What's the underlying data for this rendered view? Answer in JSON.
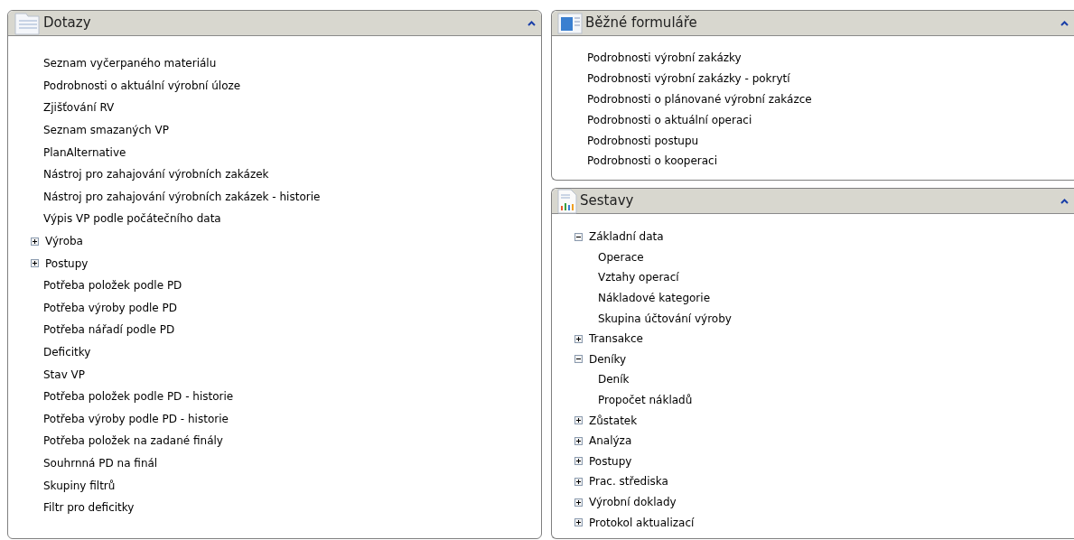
{
  "panels": [
    {
      "title": "Dotazy",
      "items": [
        {
          "kind": "link",
          "label": "Seznam vyčerpaného materiálu"
        },
        {
          "kind": "link",
          "label": "Podrobnosti o aktuální výrobní úloze"
        },
        {
          "kind": "link",
          "label": "Zjišťování RV"
        },
        {
          "kind": "link",
          "label": "Seznam smazaných VP"
        },
        {
          "kind": "link",
          "label": "PlanAlternative"
        },
        {
          "kind": "link",
          "label": "Nástroj pro zahajování výrobních zakázek"
        },
        {
          "kind": "link",
          "label": "Nástroj pro zahajování výrobních zakázek - historie"
        },
        {
          "kind": "link",
          "label": "Výpis VP podle počátečního data"
        },
        {
          "kind": "group",
          "label": "Výroba",
          "expanded": false
        },
        {
          "kind": "group",
          "label": "Postupy",
          "expanded": false
        },
        {
          "kind": "link",
          "label": "Potřeba položek podle PD"
        },
        {
          "kind": "link",
          "label": "Potřeba výroby podle PD"
        },
        {
          "kind": "link",
          "label": "Potřeba nářadí podle PD"
        },
        {
          "kind": "link",
          "label": "Deficitky"
        },
        {
          "kind": "link",
          "label": "Stav VP"
        },
        {
          "kind": "link",
          "label": "Potřeba položek podle PD - historie"
        },
        {
          "kind": "link",
          "label": "Potřeba výroby podle PD - historie"
        },
        {
          "kind": "link",
          "label": "Potřeba položek na zadané finály"
        },
        {
          "kind": "link",
          "label": "Souhrnná PD na finál"
        },
        {
          "kind": "link",
          "label": "Skupiny filtrů"
        },
        {
          "kind": "link",
          "label": "Filtr pro deficitky"
        }
      ]
    },
    {
      "title": "Běžné formuláře",
      "items": [
        {
          "kind": "link",
          "label": "Podrobnosti výrobní zakázky"
        },
        {
          "kind": "link",
          "label": "Podrobnosti výrobní zakázky - pokrytí"
        },
        {
          "kind": "link",
          "label": "Podrobnosti o plánované výrobní zakázce"
        },
        {
          "kind": "link",
          "label": "Podrobnosti o aktuální operaci"
        },
        {
          "kind": "link",
          "label": "Podrobnosti postupu"
        },
        {
          "kind": "link",
          "label": "Podrobnosti o kooperaci"
        }
      ]
    },
    {
      "title": "Sestavy",
      "items": [
        {
          "kind": "group",
          "label": "Základní data",
          "expanded": true,
          "children": [
            {
              "kind": "link",
              "label": "Operace"
            },
            {
              "kind": "link",
              "label": "Vztahy operací"
            },
            {
              "kind": "link",
              "label": "Nákladové kategorie"
            },
            {
              "kind": "link",
              "label": "Skupina účtování výroby"
            }
          ]
        },
        {
          "kind": "group",
          "label": "Transakce",
          "expanded": false
        },
        {
          "kind": "group",
          "label": "Deníky",
          "expanded": true,
          "children": [
            {
              "kind": "link",
              "label": "Deník"
            },
            {
              "kind": "link",
              "label": "Propočet nákladů"
            }
          ]
        },
        {
          "kind": "group",
          "label": "Zůstatek",
          "expanded": false
        },
        {
          "kind": "group",
          "label": "Analýza",
          "expanded": false
        },
        {
          "kind": "group",
          "label": "Postupy",
          "expanded": false
        },
        {
          "kind": "group",
          "label": "Prac. střediska",
          "expanded": false
        },
        {
          "kind": "group",
          "label": "Výrobní doklady",
          "expanded": false
        },
        {
          "kind": "group",
          "label": "Protokol aktualizací",
          "expanded": false
        }
      ]
    }
  ]
}
